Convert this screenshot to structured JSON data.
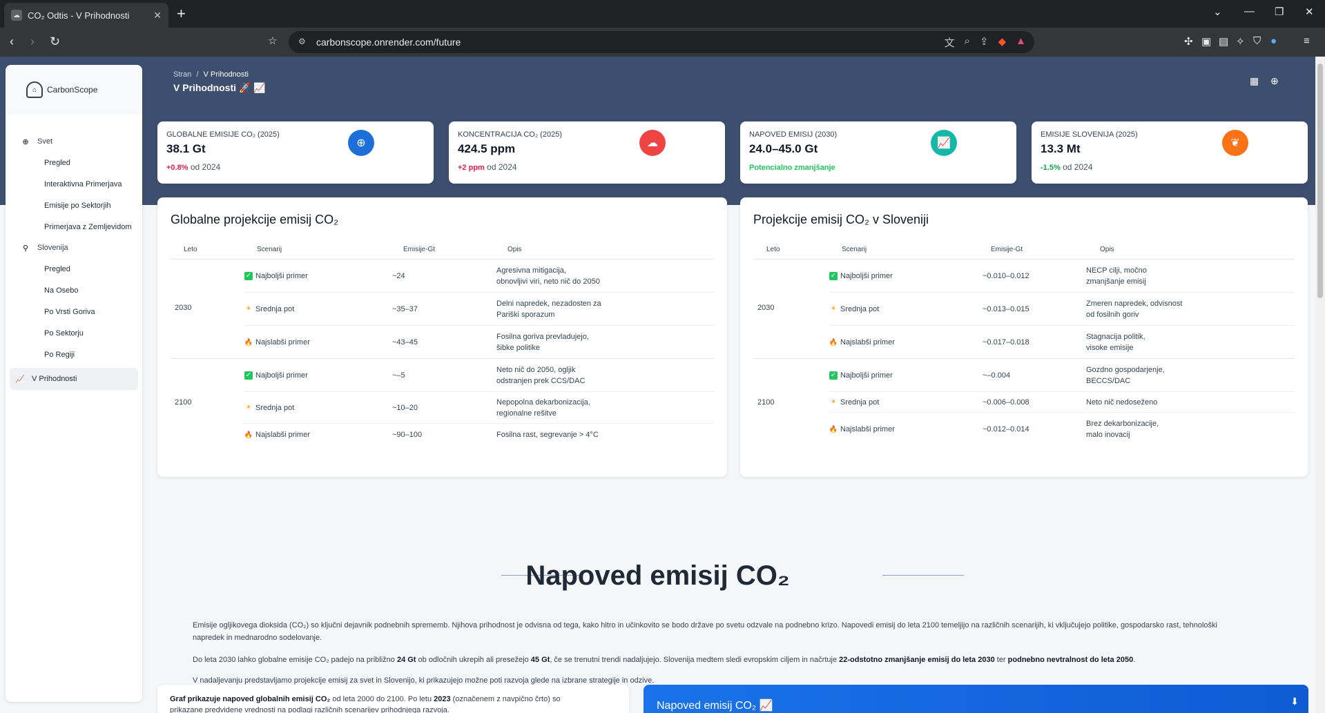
{
  "browser": {
    "tab_title": "CO₂ Odtis - V Prihodnosti",
    "url": "carbonscope.onrender.com/future"
  },
  "sidebar": {
    "brand": "CarbonScope",
    "groups": [
      {
        "label": "Svet",
        "items": [
          "Pregled",
          "Interaktivna Primerjava",
          "Emisije po Sektorjih",
          "Primerjava z Zemljevidom"
        ]
      },
      {
        "label": "Slovenija",
        "items": [
          "Pregled",
          "Na Osebo",
          "Po Vrsti Goriva",
          "Po Sektorju",
          "Po Regiji"
        ]
      }
    ],
    "active": "V Prihodnosti"
  },
  "header": {
    "crumb_root": "Stran",
    "crumb_sep": "/",
    "crumb_current": "V Prihodnosti",
    "title": "V Prihodnosti 🚀 📈"
  },
  "stats": [
    {
      "label": "Globalne emisije CO₂ (2025)",
      "value": "38.1 Gt",
      "change": "+0.8%",
      "suffix": " od 2024",
      "change_color": "#e11d48",
      "icon": "globe-icon",
      "icon_bg": "#1d6fd8"
    },
    {
      "label": "Koncentracija CO₂ (2025)",
      "value": "424.5 ppm",
      "change": "+2 ppm",
      "suffix": " od 2024",
      "change_color": "#e11d48",
      "icon": "cloud-icon",
      "icon_bg": "#ef4444"
    },
    {
      "label": "Napoved emisij (2030)",
      "value": "24.0–45.0 Gt",
      "change": "Potencialno zmanjšanje",
      "suffix": "",
      "change_color": "#22c55e",
      "icon": "chart-icon",
      "icon_bg": "#14b8a6"
    },
    {
      "label": "Emisije Slovenija (2025)",
      "value": "13.3 Mt",
      "change": "-1.5%",
      "suffix": " od 2024",
      "change_color": "#16a34a",
      "icon": "leaf-icon",
      "icon_bg": "#f97316"
    }
  ],
  "global_table": {
    "title": "Globalne projekcije emisij CO₂",
    "headers": [
      "Leto",
      "Scenarij",
      "Emisije-Gt",
      "Opis"
    ],
    "groups": [
      {
        "year": "2030",
        "rows": [
          {
            "kind": "best",
            "scenario": "Najboljši primer",
            "value": "~24",
            "desc": [
              "Agresivna mitigacija,",
              "obnovljivi viri, neto nič do 2050"
            ]
          },
          {
            "kind": "mid",
            "scenario": "Srednja pot",
            "value": "~35–37",
            "desc": [
              "Delni napredek, nezadosten za",
              "Pariški sporazum"
            ]
          },
          {
            "kind": "worst",
            "scenario": "Najslabši primer",
            "value": "~43–45",
            "desc": [
              "Fosilna goriva prevladujejo,",
              "šibke politike"
            ]
          }
        ]
      },
      {
        "year": "2100",
        "rows": [
          {
            "kind": "best",
            "scenario": "Najboljši primer",
            "value": "~–5",
            "desc": [
              "Neto nič do 2050, ogljik",
              "odstranjen prek CCS/DAC"
            ]
          },
          {
            "kind": "mid",
            "scenario": "Srednja pot",
            "value": "~10–20",
            "desc": [
              "Nepopolna dekarbonizacija,",
              "regionalne rešitve"
            ]
          },
          {
            "kind": "worst",
            "scenario": "Najslabši primer",
            "value": "~90–100",
            "desc": [
              "Fosilna rast, segrevanje > 4°C"
            ]
          }
        ]
      }
    ]
  },
  "slo_table": {
    "title": "Projekcije emisij CO₂ v Sloveniji",
    "headers": [
      "Leto",
      "Scenarij",
      "Emisije-Gt",
      "Opis"
    ],
    "groups": [
      {
        "year": "2030",
        "rows": [
          {
            "kind": "best",
            "scenario": "Najboljši primer",
            "value": "~0.010–0.012",
            "desc": [
              "NECP cilji, močno",
              "zmanjšanje emisij"
            ]
          },
          {
            "kind": "mid",
            "scenario": "Srednja pot",
            "value": "~0.013–0.015",
            "desc": [
              "Zmeren napredek, odvisnost",
              "od fosilnih goriv"
            ]
          },
          {
            "kind": "worst",
            "scenario": "Najslabši primer",
            "value": "~0.017–0.018",
            "desc": [
              "Stagnacija politik,",
              "visoke emisije"
            ]
          }
        ]
      },
      {
        "year": "2100",
        "rows": [
          {
            "kind": "best",
            "scenario": "Najboljši primer",
            "value": "~–0.004",
            "desc": [
              "Gozdno gospodarjenje,",
              "BECCS/DAC"
            ]
          },
          {
            "kind": "mid",
            "scenario": "Srednja pot",
            "value": "~0.006–0.008",
            "desc": [
              "Neto nič nedoseženo"
            ]
          },
          {
            "kind": "worst",
            "scenario": "Najslabši primer",
            "value": "~0.012–0.014",
            "desc": [
              "Brez dekarbonizacije,",
              "malo inovacij"
            ]
          }
        ]
      }
    ]
  },
  "section": {
    "title": "Napoved emisij CO₂",
    "p1": "Emisije ogljikovega dioksida (CO₂) so ključni dejavnik podnebnih sprememb. Njihova prihodnost je odvisna od tega, kako hitro in učinkovito se bodo države po svetu odzvale na podnebno krizo. Napovedi emisij do leta 2100 temeljijo na različnih scenarijih, ki vključujejo politike, gospodarsko rast, tehnološki napredek in mednarodno sodelovanje.",
    "p2_a": "Do leta 2030 lahko globalne emisije CO₂ padejo na približno ",
    "p2_b": "24 Gt",
    "p2_c": " ob odločnih ukrepih ali presežejo ",
    "p2_d": "45 Gt",
    "p2_e": ", če se trenutni trendi nadaljujejo. Slovenija medtem sledi evropskim ciljem in načrtuje ",
    "p2_f": "22-odstotno zmanjšanje emisij do leta 2030",
    "p2_g": " ter ",
    "p2_h": "podnebno nevtralnost do leta 2050",
    "p2_i": ".",
    "p3": "V nadaljevanju predstavljamo projekcije emisij za svet in Slovenijo, ki prikazujejo možne poti razvoja glede na izbrane strategije in odzive."
  },
  "bottom": {
    "text_a": "Graf prikazuje napoved globalnih emisij CO₂",
    "text_b": " od leta 2000 do 2100. Po letu ",
    "text_c": "2023",
    "text_d": " (označenem z navpično črto) so",
    "text_e": "prikazane predvidene vrednosti na podlagi različnih scenarijev prihodnjega razvoja.",
    "chart_title": "Napoved emisij CO₂ 📈"
  }
}
